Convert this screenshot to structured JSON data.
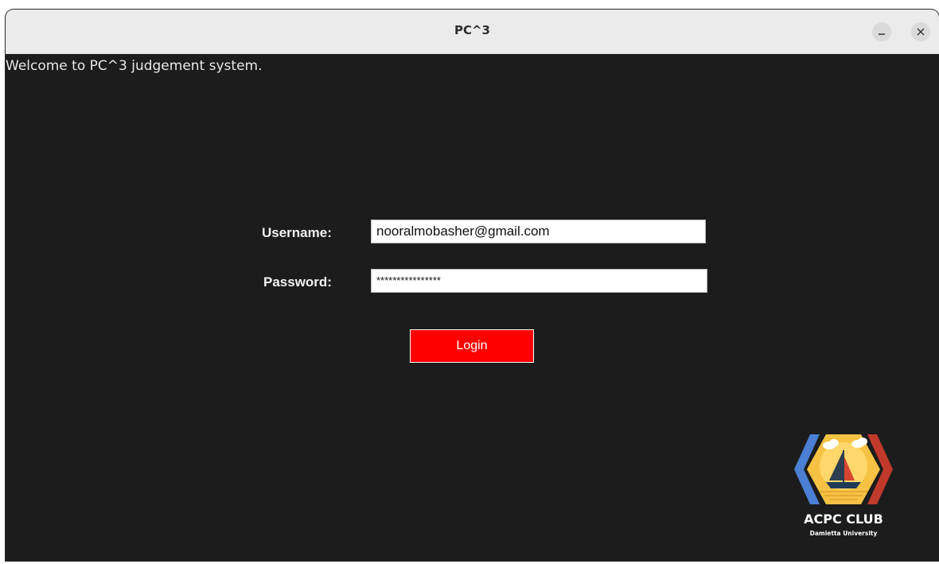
{
  "window": {
    "title": "PC^3",
    "minimize_symbol": "–",
    "close_symbol": "×"
  },
  "main": {
    "welcome_text": "Welcome to PC^3 judgement system.",
    "username_label": "Username:",
    "username_value": "nooralmobasher@gmail.com",
    "password_label": "Password:",
    "password_value": "****************",
    "login_button": "Login"
  },
  "logo": {
    "title": "ACPC CLUB",
    "subtitle": "Damietta University"
  },
  "colors": {
    "background": "#1c1c1c",
    "login_button": "#ff0000",
    "logo_blue": "#4a7fd4",
    "logo_red": "#c0392b",
    "logo_yellow": "#f6c244"
  }
}
